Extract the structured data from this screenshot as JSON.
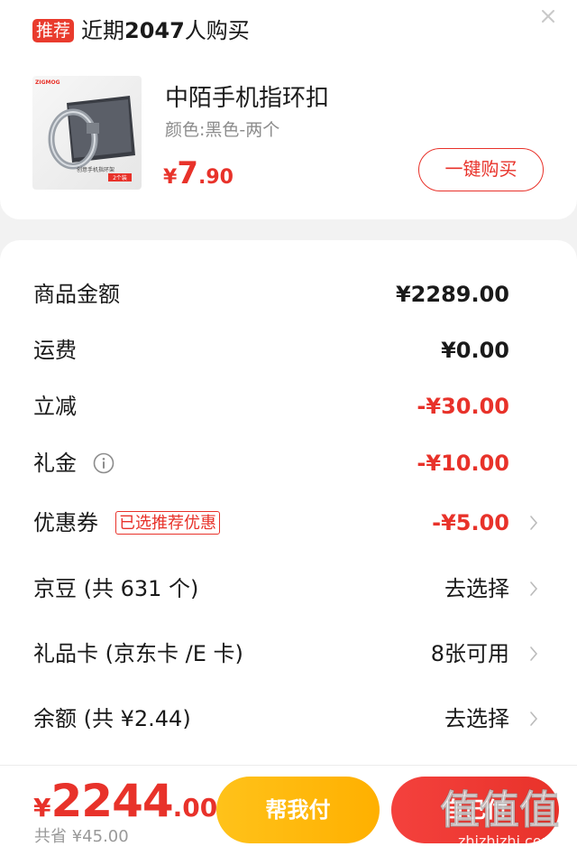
{
  "top": {
    "tag": "推荐",
    "headline_pre": "近期",
    "headline_count": "2047",
    "headline_post": "人购买"
  },
  "product": {
    "title": "中陌手机指环扣",
    "spec": "颜色:黑色-两个",
    "price_currency": "¥",
    "price_int": "7",
    "price_dec": ".90",
    "buy_label": "一键购买",
    "thumb_brand": "ZIGMOG",
    "thumb_caption": "创意手机指环架",
    "thumb_badge": "2个装"
  },
  "details": {
    "rows": [
      {
        "label": "商品金额",
        "value": "¥2289.00"
      },
      {
        "label": "运费",
        "value": "¥0.00"
      },
      {
        "label": "立减",
        "value": "-¥30.00"
      },
      {
        "label": "礼金",
        "value": "-¥10.00"
      },
      {
        "label": "优惠券",
        "tag": "已选推荐优惠",
        "value": "-¥5.00"
      },
      {
        "label": "京豆 (共 631 个)",
        "value": "去选择"
      },
      {
        "label": "礼品卡 (京东卡 /E 卡)",
        "value": "8张可用"
      },
      {
        "label": "余额 (共 ¥2.44)",
        "value": "去选择"
      }
    ]
  },
  "bottom": {
    "total_currency": "¥",
    "total_int": "2244",
    "total_dec": ".00",
    "saved": "共省 ¥45.00",
    "help_pay": "帮我付",
    "self_pay": "自己付"
  },
  "watermark": {
    "chars": "值值值",
    "site": "zhizhizhi.com"
  },
  "colors": {
    "accent_red": "#e8322a",
    "help_yellow": "#ffb000",
    "muted_text": "#8c8c8c"
  },
  "icons": [
    "close-icon",
    "info-icon",
    "chevron-right-icon"
  ]
}
